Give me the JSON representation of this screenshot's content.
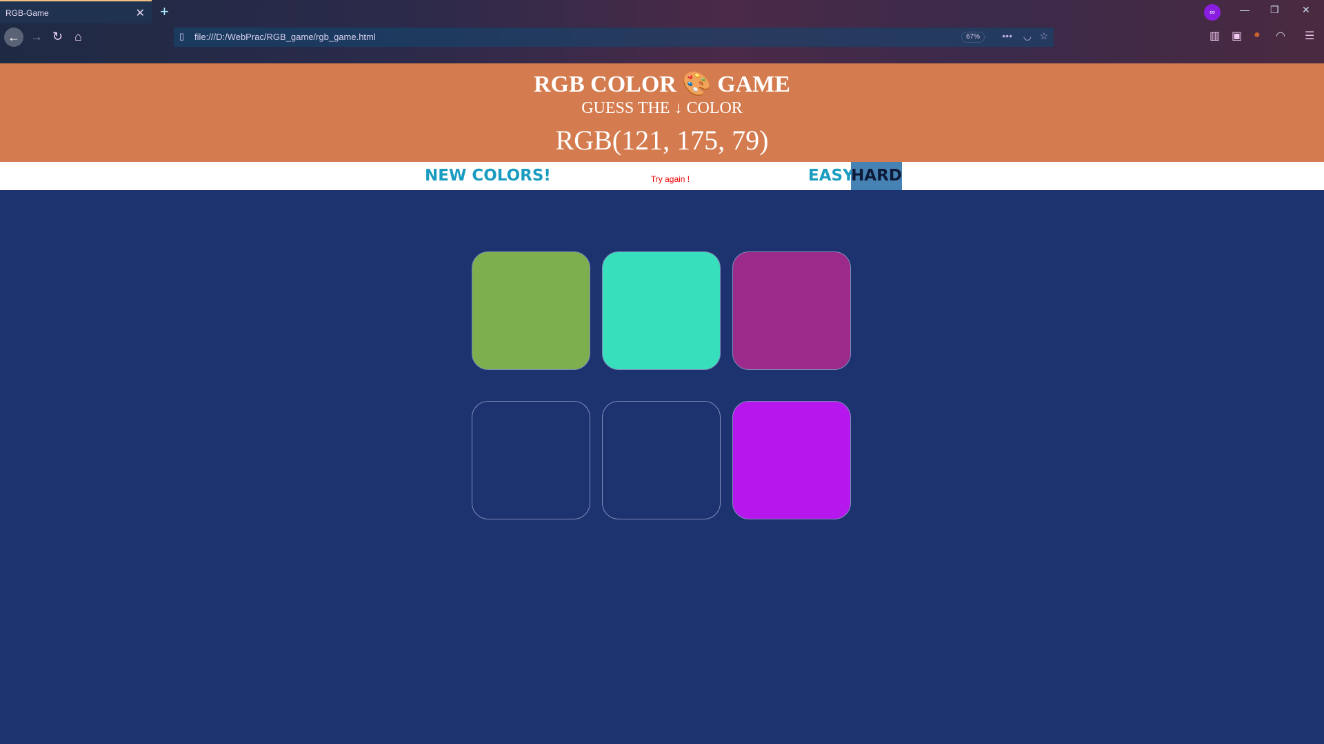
{
  "browser": {
    "tab_title": "RGB-Game",
    "url": "file:///D:/WebPrac/RGB_game/rgb_game.html",
    "zoom": "67%"
  },
  "header": {
    "title_left": "RGB COLOR",
    "title_icon": "palette-icon",
    "title_right": "GAME",
    "subtitle_left": "GUESS THE",
    "subtitle_icon": "arrow-down-icon",
    "subtitle_right": "COLOR",
    "target": "RGB(121, 175, 79)"
  },
  "controls": {
    "new_colors": "NEW COLORS!",
    "message": "Try again !",
    "easy": "EASY",
    "hard": "HARD",
    "selected_mode": "HARD"
  },
  "colors": {
    "header_bg": "#d47c4f",
    "page_bg": "#1d3370",
    "button_text": "#1a9cc0",
    "selected_bg": "#4682b4",
    "message": "#e00000"
  },
  "squares": [
    {
      "color": "#7daf4f"
    },
    {
      "color": "#38dfbd"
    },
    {
      "color": "#9c2a8a"
    },
    {
      "color": "#1d3370"
    },
    {
      "color": "#1d3370"
    },
    {
      "color": "#b517ec"
    }
  ]
}
